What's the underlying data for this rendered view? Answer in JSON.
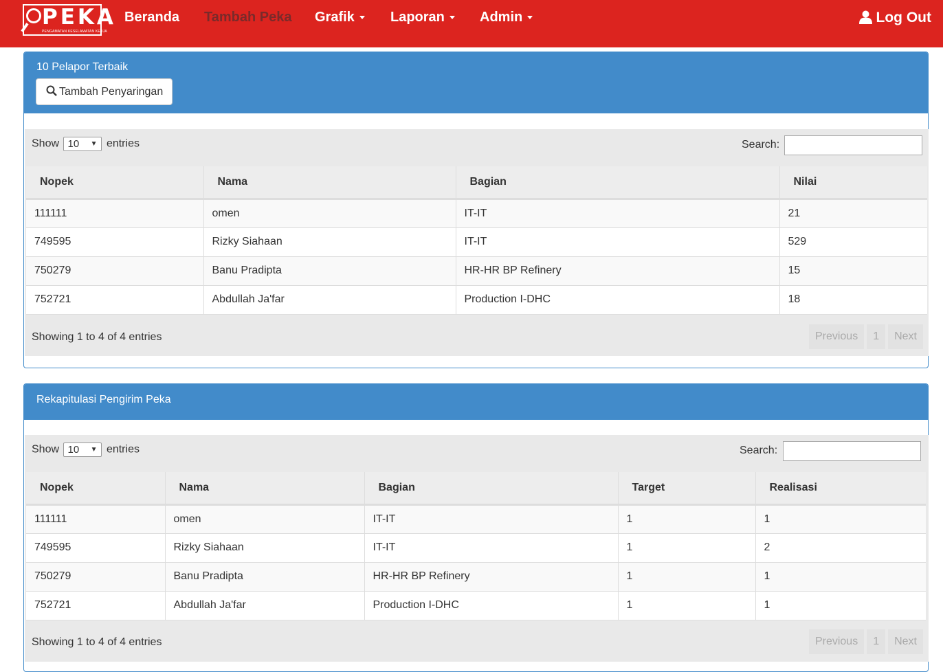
{
  "nav": {
    "logo_text": "PEKA",
    "logo_subtitle": "PENGAMATAN KESELAMATAN KERJA",
    "items": [
      {
        "label": "Beranda",
        "dropdown": false
      },
      {
        "label": "Tambah Peka",
        "dropdown": false
      },
      {
        "label": "Grafik",
        "dropdown": true
      },
      {
        "label": "Laporan",
        "dropdown": true
      },
      {
        "label": "Admin",
        "dropdown": true
      }
    ],
    "logout_label": "Log Out"
  },
  "panel1": {
    "title": "10 Pelapor Terbaik",
    "filter_button": "Tambah Penyaringan",
    "show_label": "Show",
    "entries_value": "10",
    "entries_label": "entries",
    "search_label": "Search:",
    "search_value": "",
    "columns": [
      "Nopek",
      "Nama",
      "Bagian",
      "Nilai"
    ],
    "rows": [
      [
        "111111",
        "omen",
        "IT-IT",
        "21"
      ],
      [
        "749595",
        "Rizky Siahaan",
        "IT-IT",
        "529"
      ],
      [
        "750279",
        "Banu Pradipta",
        "HR-HR BP Refinery",
        "15"
      ],
      [
        "752721",
        "Abdullah Ja'far",
        "Production I-DHC",
        "18"
      ]
    ],
    "info": "Showing 1 to 4 of 4 entries",
    "pager": {
      "previous": "Previous",
      "page": "1",
      "next": "Next"
    }
  },
  "panel2": {
    "title": "Rekapitulasi Pengirim Peka",
    "show_label": "Show",
    "entries_value": "10",
    "entries_label": "entries",
    "search_label": "Search:",
    "search_value": "",
    "columns": [
      "Nopek",
      "Nama",
      "Bagian",
      "Target",
      "Realisasi"
    ],
    "rows": [
      [
        "111111",
        "omen",
        "IT-IT",
        "1",
        "1"
      ],
      [
        "749595",
        "Rizky Siahaan",
        "IT-IT",
        "1",
        "2"
      ],
      [
        "750279",
        "Banu Pradipta",
        "HR-HR BP Refinery",
        "1",
        "1"
      ],
      [
        "752721",
        "Abdullah Ja'far",
        "Production I-DHC",
        "1",
        "1"
      ]
    ],
    "info": "Showing 1 to 4 of 4 entries",
    "pager": {
      "previous": "Previous",
      "page": "1",
      "next": "Next"
    }
  },
  "colors": {
    "navbar": "#dc241f",
    "panel_header": "#428bca",
    "muted_nav": "#7a2a2a"
  }
}
